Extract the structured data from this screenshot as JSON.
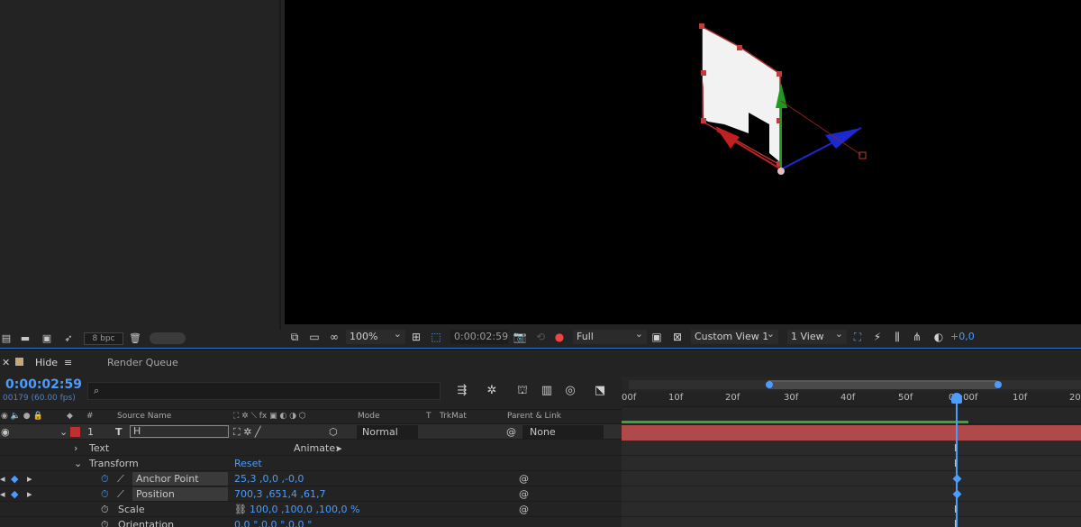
{
  "project_footer": {
    "bpc": "8 bpc"
  },
  "viewer_toolbar": {
    "zoom": "100%",
    "timecode": "0:00:02:59",
    "resolution": "Full",
    "view": "Custom View 1",
    "views_count": "1 View",
    "exposure": "+0,0"
  },
  "timeline": {
    "tab_label": "Hide",
    "other_tab": "Render Queue",
    "timecode": "0:00:02:59",
    "frames_fps": "00179 (60.00 fps)",
    "columns": {
      "hash": "#",
      "source_name": "Source Name",
      "mode": "Mode",
      "t": "T",
      "trkmat": "TrkMat",
      "parent": "Parent & Link"
    },
    "layer": {
      "index": "1",
      "type_glyph": "T",
      "name": "H",
      "mode": "Normal",
      "parent": "None"
    },
    "properties": {
      "text_label": "Text",
      "animate_label": "Animate:",
      "transform_label": "Transform",
      "reset_label": "Reset",
      "anchor_label": "Anchor Point",
      "anchor_value": "25,3 ,0,0 ,-0,0",
      "position_label": "Position",
      "position_value": "700,3 ,651,4 ,61,7",
      "scale_label": "Scale",
      "scale_value": "100,0 ,100,0 ,100,0 %",
      "orientation_label": "Orientation",
      "orientation_value": "0,0 °,0,0 °,0,0 °"
    },
    "ruler_ticks": [
      "00f",
      "10f",
      "20f",
      "30f",
      "40f",
      "50f",
      "03:00f",
      "10f",
      "20f"
    ],
    "accent_color": "#4a9cff",
    "layer_bar_color": "#b04a4a"
  },
  "viewer": {
    "letter": "H"
  }
}
